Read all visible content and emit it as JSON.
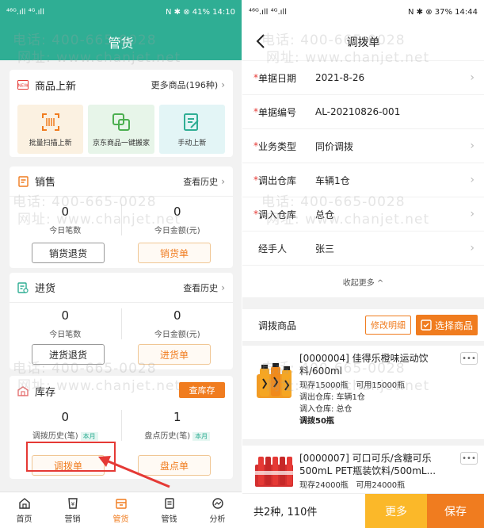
{
  "left": {
    "status": {
      "signal": "⁴⁶ᴳ.ıll ⁴ᴳ.ıll",
      "right": "N ✱ ⊗ 41% 14:10"
    },
    "title": "管货",
    "new_goods": {
      "title": "商品上新",
      "more": "更多商品(196种)",
      "tiles": [
        {
          "label": "批量扫描上新",
          "icon": "barcode-scan-icon",
          "bg": "#fbf1e1"
        },
        {
          "label": "京东商品一键搬家",
          "icon": "copy-icon",
          "bg": "#e7f5e9"
        },
        {
          "label": "手动上新",
          "icon": "edit-doc-icon",
          "bg": "#e3f5f6"
        }
      ]
    },
    "sales": {
      "title": "销售",
      "more": "查看历史",
      "stats": [
        {
          "num": "0",
          "label": "今日笔数"
        },
        {
          "num": "0",
          "label": "今日金额(元)"
        }
      ],
      "btn_return": "销货退货",
      "btn_order": "销货单"
    },
    "purchase": {
      "title": "进货",
      "more": "查看历史",
      "stats": [
        {
          "num": "0",
          "label": "今日笔数"
        },
        {
          "num": "0",
          "label": "今日金额(元)"
        }
      ],
      "btn_return": "进货退货",
      "btn_order": "进货单"
    },
    "inventory": {
      "title": "库存",
      "check_btn": "查库存",
      "stats": [
        {
          "num": "0",
          "label": "调拨历史(笔)",
          "badge": "本月"
        },
        {
          "num": "1",
          "label": "盘点历史(笔)",
          "badge": "本月"
        }
      ],
      "btn_transfer": "调拨单",
      "btn_count": "盘点单"
    },
    "tabs": [
      {
        "label": "首页",
        "icon": "home-icon"
      },
      {
        "label": "营销",
        "icon": "marketing-icon"
      },
      {
        "label": "管货",
        "icon": "goods-icon",
        "active": true
      },
      {
        "label": "管钱",
        "icon": "money-icon"
      },
      {
        "label": "分析",
        "icon": "analysis-icon"
      }
    ]
  },
  "right": {
    "status": {
      "signal": "⁴⁶ᴳ.ıll ⁴ᴳ.ıll",
      "right": "N ✱ ⊗ 37% 14:44"
    },
    "title": "调拨单",
    "fields": [
      {
        "label": "单据日期",
        "value": "2021-8-26",
        "required": true
      },
      {
        "label": "单据编号",
        "value": "AL-20210826-001",
        "required": true
      },
      {
        "label": "业务类型",
        "value": "同价调拨",
        "required": true
      },
      {
        "label": "调出仓库",
        "value": "车辆1仓",
        "required": true
      },
      {
        "label": "调入仓库",
        "value": "总仓",
        "required": true
      },
      {
        "label": "经手人",
        "value": "张三",
        "required": false
      }
    ],
    "collapse": "收起更多 ^",
    "goods_title": "调拨商品",
    "edit_btn": "修改明细",
    "select_btn": "选择商品",
    "items": [
      {
        "name": "[0000004] 佳得乐橙味运动饮料/600ml",
        "stock": "现存15000瓶",
        "avail": "可用15000瓶",
        "out": "调出仓库: 车辆1仓",
        "in": "调入仓库: 总仓",
        "qty": "调拨50瓶"
      },
      {
        "name": "[0000007] 可口可乐/含糖可乐 500mL PET瓶装饮料/500mL...",
        "stock": "现存24000瓶",
        "avail": "可用24000瓶"
      }
    ],
    "total": "共2种, 110件",
    "more_btn": "更多",
    "save_btn": "保存"
  },
  "watermark": {
    "phone": "电话: 400-665-0028",
    "web": "网址: www.chanjet.net"
  },
  "colors": {
    "brand": "#2fae94",
    "accent": "#f07c1f",
    "highlight": "#e53935",
    "more": "#fbb829"
  }
}
